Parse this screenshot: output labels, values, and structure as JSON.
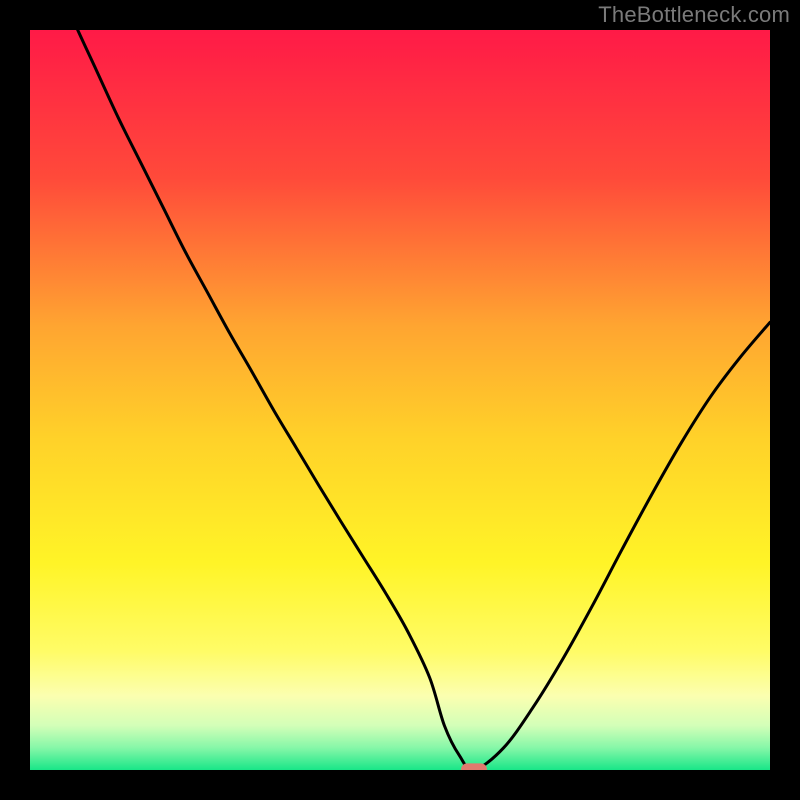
{
  "watermark": "TheBottleneck.com",
  "gradient_stops": [
    {
      "offset": 0.0,
      "color": "#ff1a47"
    },
    {
      "offset": 0.2,
      "color": "#ff4a3a"
    },
    {
      "offset": 0.4,
      "color": "#ffa531"
    },
    {
      "offset": 0.55,
      "color": "#ffd129"
    },
    {
      "offset": 0.72,
      "color": "#fff427"
    },
    {
      "offset": 0.84,
      "color": "#fffc67"
    },
    {
      "offset": 0.9,
      "color": "#fbffb0"
    },
    {
      "offset": 0.94,
      "color": "#d3ffb8"
    },
    {
      "offset": 0.97,
      "color": "#86f7a8"
    },
    {
      "offset": 1.0,
      "color": "#19e688"
    }
  ],
  "marker": {
    "enabled": true,
    "color": "#e07a6e",
    "width_frac": 0.035,
    "height_frac": 0.018
  },
  "chart_data": {
    "type": "line",
    "title": "",
    "xlabel": "",
    "ylabel": "",
    "xlim": [
      0,
      100
    ],
    "ylim": [
      0,
      100
    ],
    "grid": false,
    "x": [
      0,
      3,
      6,
      9,
      12,
      15,
      18,
      21,
      24,
      27,
      30,
      33,
      36,
      39,
      42,
      45,
      48,
      51,
      54,
      56,
      58,
      60,
      64,
      68,
      72,
      76,
      80,
      84,
      88,
      92,
      96,
      100
    ],
    "values": [
      115,
      108,
      101,
      94.5,
      88,
      82,
      76,
      70,
      64.5,
      59,
      53.8,
      48.5,
      43.5,
      38.5,
      33.6,
      28.8,
      24.0,
      18.8,
      12.5,
      6.0,
      2.0,
      0.0,
      3.0,
      8.5,
      15.0,
      22.2,
      29.8,
      37.2,
      44.2,
      50.5,
      55.8,
      60.5
    ],
    "min_x": 60,
    "min_y": 0
  }
}
